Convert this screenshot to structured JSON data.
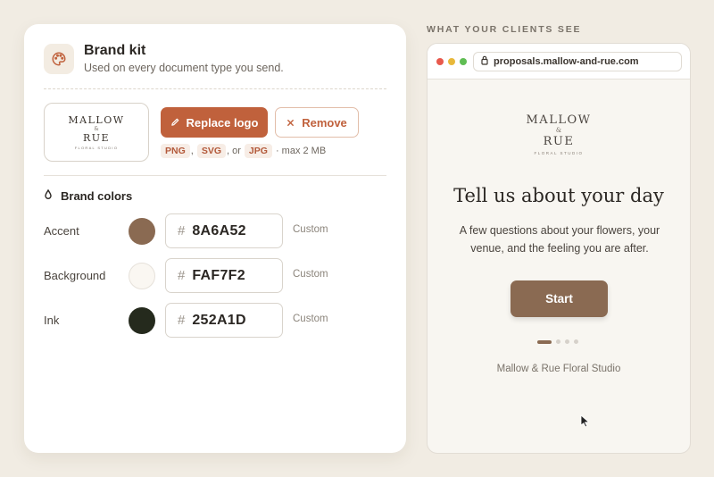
{
  "brand_kit": {
    "title": "Brand kit",
    "subtitle": "Used on every document type you send.",
    "icon": "palette-icon",
    "logo": {
      "line1": "MALLOW",
      "amp": "&",
      "line2": "RUE",
      "tagline": "FLORAL STUDIO"
    },
    "replace_label": "Replace logo",
    "remove_label": "Remove",
    "formats": {
      "f1": "PNG",
      "f2": "SVG",
      "f3": "JPG",
      "sep1": ",",
      "sep2": ", or",
      "note": "· max 2 MB"
    },
    "brand_colors_title": "Brand colors",
    "colors": [
      {
        "label": "Accent",
        "hash": "#",
        "value": "8A6A52",
        "swatch": "#8a6a52",
        "mode": "Custom"
      },
      {
        "label": "Background",
        "hash": "#",
        "value": "FAF7F2",
        "swatch": "#faf7f2",
        "mode": "Custom"
      },
      {
        "label": "Ink",
        "hash": "#",
        "value": "252A1D",
        "swatch": "#252a1d",
        "mode": "Custom"
      }
    ]
  },
  "preview": {
    "caption": "WHAT YOUR CLIENTS SEE",
    "url": "proposals.mallow-and-rue.com",
    "logo": {
      "line1": "MALLOW",
      "amp": "&",
      "line2": "RUE",
      "tagline": "FLORAL STUDIO"
    },
    "heading": "Tell us about your day",
    "body": "A few questions about your flowers, your venue, and the feeling you are after.",
    "start_label": "Start",
    "step": {
      "current": 1,
      "total": 4
    },
    "footer": "Mallow & Rue Floral Studio"
  },
  "colors": {
    "accent_orange": "#c0613c",
    "preview_accent": "#8a6a52",
    "page_bg": "#f1ece3"
  }
}
